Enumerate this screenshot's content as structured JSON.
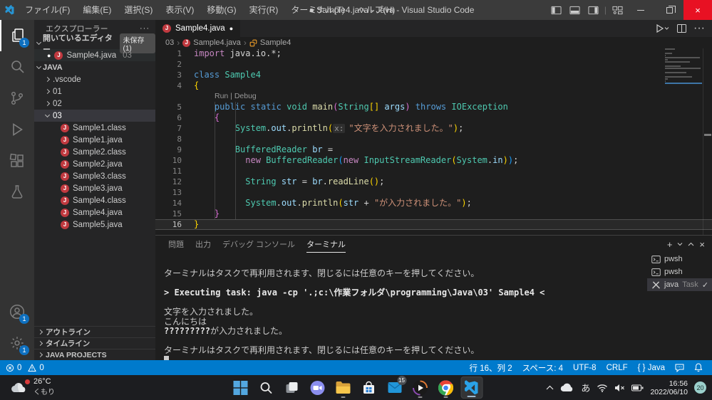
{
  "window": {
    "title": "● Sample4.java - Java - Visual Studio Code",
    "menus": [
      {
        "label": "ファイル(F)"
      },
      {
        "label": "編集(E)"
      },
      {
        "label": "選択(S)"
      },
      {
        "label": "表示(V)"
      },
      {
        "label": "移動(G)"
      },
      {
        "label": "実行(R)"
      },
      {
        "label": "ターミナル(T)"
      },
      {
        "label": "ヘルプ(H)"
      }
    ]
  },
  "activity_bar": {
    "top": [
      {
        "name": "explorer",
        "active": true,
        "badge": "1"
      },
      {
        "name": "search"
      },
      {
        "name": "source-control"
      },
      {
        "name": "run-debug"
      },
      {
        "name": "extensions"
      },
      {
        "name": "testing"
      }
    ],
    "bottom": [
      {
        "name": "accounts",
        "badge": "1"
      },
      {
        "name": "settings",
        "badge": "1"
      }
    ]
  },
  "sidebar": {
    "title": "エクスプローラー",
    "open_editors": {
      "label": "開いているエディター",
      "badge": "未保存 (1)",
      "items": [
        {
          "name": "Sample4.java",
          "folder": "03",
          "modified": true
        }
      ]
    },
    "workspace_label": "JAVA",
    "folders": [
      {
        "name": ".vscode"
      },
      {
        "name": "01"
      },
      {
        "name": "02"
      },
      {
        "name": "03",
        "expanded": true,
        "selected": true
      }
    ],
    "files": [
      "Sample1.class",
      "Sample1.java",
      "Sample2.class",
      "Sample2.java",
      "Sample3.class",
      "Sample3.java",
      "Sample4.class",
      "Sample4.java",
      "Sample5.java"
    ],
    "sections": [
      "アウトライン",
      "タイムライン",
      "JAVA PROJECTS"
    ]
  },
  "editor": {
    "tab": {
      "label": "Sample4.java",
      "modified": true
    },
    "breadcrumb": [
      "03",
      "Sample4.java",
      "Sample4"
    ],
    "code_lines": [
      {
        "n": "1",
        "t": [
          [
            "kw2",
            "import"
          ],
          [
            "pl",
            " java.io.*;"
          ]
        ]
      },
      {
        "n": "2",
        "t": []
      },
      {
        "n": "3",
        "t": [
          [
            "kw",
            "class"
          ],
          [
            "pl",
            " "
          ],
          [
            "ty",
            "Sample4"
          ]
        ]
      },
      {
        "n": "4",
        "t": [
          [
            "b1",
            "{"
          ]
        ]
      },
      {
        "lens": "Run | Debug"
      },
      {
        "n": "5",
        "t": [
          [
            "pl",
            "    "
          ],
          [
            "kw",
            "public"
          ],
          [
            "pl",
            " "
          ],
          [
            "kw",
            "static"
          ],
          [
            "pl",
            " "
          ],
          [
            "ty",
            "void"
          ],
          [
            "pl",
            " "
          ],
          [
            "fn",
            "main"
          ],
          [
            "b2",
            "("
          ],
          [
            "ty",
            "String"
          ],
          [
            "b1",
            "[]"
          ],
          [
            "pl",
            " "
          ],
          [
            "vr",
            "args"
          ],
          [
            "b2",
            ")"
          ],
          [
            "pl",
            " "
          ],
          [
            "kw",
            "throws"
          ],
          [
            "pl",
            " "
          ],
          [
            "ty",
            "IOException"
          ]
        ]
      },
      {
        "n": "6",
        "t": [
          [
            "pl",
            "    "
          ],
          [
            "b2",
            "{"
          ]
        ]
      },
      {
        "n": "7",
        "t": [
          [
            "pl",
            "        "
          ],
          [
            "ty",
            "System"
          ],
          [
            "pl",
            "."
          ],
          [
            "vr",
            "out"
          ],
          [
            "pl",
            "."
          ],
          [
            "fn",
            "println"
          ],
          [
            "b1",
            "("
          ],
          [
            "in",
            "x:"
          ],
          [
            "st",
            "\"文字を入力されました。\""
          ],
          [
            "b1",
            ")"
          ],
          [
            "pl",
            ";"
          ]
        ]
      },
      {
        "n": "8",
        "t": []
      },
      {
        "n": "9",
        "t": [
          [
            "pl",
            "        "
          ],
          [
            "ty",
            "BufferedReader"
          ],
          [
            "pl",
            " "
          ],
          [
            "vr",
            "br"
          ],
          [
            "pl",
            " ="
          ]
        ]
      },
      {
        "n": "10",
        "t": [
          [
            "pl",
            "          "
          ],
          [
            "kw2",
            "new"
          ],
          [
            "pl",
            " "
          ],
          [
            "ty",
            "BufferedReader"
          ],
          [
            "b3",
            "("
          ],
          [
            "kw2",
            "new"
          ],
          [
            "pl",
            " "
          ],
          [
            "ty",
            "InputStreamReader"
          ],
          [
            "b1",
            "("
          ],
          [
            "ty",
            "System"
          ],
          [
            "pl",
            "."
          ],
          [
            "vr",
            "in"
          ],
          [
            "b1",
            ")"
          ],
          [
            "b3",
            ")"
          ],
          [
            "pl",
            ";"
          ]
        ]
      },
      {
        "n": "11",
        "t": []
      },
      {
        "n": "12",
        "t": [
          [
            "pl",
            "          "
          ],
          [
            "ty",
            "String"
          ],
          [
            "pl",
            " "
          ],
          [
            "vr",
            "str"
          ],
          [
            "pl",
            " = "
          ],
          [
            "vr",
            "br"
          ],
          [
            "pl",
            "."
          ],
          [
            "fn",
            "readLine"
          ],
          [
            "b1",
            "()"
          ],
          [
            "pl",
            ";"
          ]
        ]
      },
      {
        "n": "13",
        "t": []
      },
      {
        "n": "14",
        "t": [
          [
            "pl",
            "          "
          ],
          [
            "ty",
            "System"
          ],
          [
            "pl",
            "."
          ],
          [
            "vr",
            "out"
          ],
          [
            "pl",
            "."
          ],
          [
            "fn",
            "println"
          ],
          [
            "b1",
            "("
          ],
          [
            "vr",
            "str"
          ],
          [
            "pl",
            " + "
          ],
          [
            "st",
            "\"が入力されました。\""
          ],
          [
            "b1",
            ")"
          ],
          [
            "pl",
            ";"
          ]
        ]
      },
      {
        "n": "15",
        "t": [
          [
            "pl",
            "    "
          ],
          [
            "b2",
            "}"
          ]
        ]
      },
      {
        "n": "16",
        "t": [
          [
            "b1",
            "}"
          ]
        ],
        "current": true
      }
    ]
  },
  "panel": {
    "tabs": [
      {
        "label": "問題"
      },
      {
        "label": "出力"
      },
      {
        "label": "デバッグ コンソール"
      },
      {
        "label": "ターミナル",
        "active": true
      }
    ],
    "terminal_lines": [
      {
        "seg": [
          {
            "t": "ターミナルはタスクで再利用されます、閉じるには任意のキーを押してください。"
          }
        ]
      },
      {
        "blank": true
      },
      {
        "seg": [
          {
            "t": "> Executing task: java -cp '.;c:\\作業フォルダ\\programming\\Java\\03' Sample4 <",
            "b": true
          }
        ]
      },
      {
        "blank": true
      },
      {
        "seg": [
          {
            "t": "文字を入力されました。"
          }
        ]
      },
      {
        "seg": [
          {
            "t": "こんにちは"
          }
        ]
      },
      {
        "seg": [
          {
            "t": "?????????",
            "b": true
          },
          {
            "t": "が入力されました。"
          }
        ]
      },
      {
        "blank": true
      },
      {
        "seg": [
          {
            "t": "ターミナルはタスクで再利用されます、閉じるには任意のキーを押してください。"
          }
        ]
      },
      {
        "cursor": true
      }
    ],
    "terminal_list": [
      {
        "icon": "terminal-icon",
        "label": "pwsh"
      },
      {
        "icon": "terminal-icon",
        "label": "pwsh"
      },
      {
        "icon": "tools-icon",
        "label": "java",
        "detail": "Task",
        "checked": true,
        "active": true
      }
    ]
  },
  "status_bar": {
    "left": [
      {
        "name": "errors",
        "value": "0"
      },
      {
        "name": "warnings",
        "value": "0"
      }
    ],
    "right": [
      {
        "name": "cursor-position",
        "label": "行 16、列 2"
      },
      {
        "name": "indentation",
        "label": "スペース: 4"
      },
      {
        "name": "encoding",
        "label": "UTF-8"
      },
      {
        "name": "eol",
        "label": "CRLF"
      },
      {
        "name": "language-mode",
        "label": "{ } Java"
      }
    ]
  },
  "taskbar": {
    "weather": {
      "temp": "26°C",
      "condition": "くもり"
    },
    "apps": [
      {
        "name": "start"
      },
      {
        "name": "search"
      },
      {
        "name": "task-view"
      },
      {
        "name": "chat"
      },
      {
        "name": "file-explorer",
        "running": true
      },
      {
        "name": "store"
      },
      {
        "name": "mail",
        "badge": "15"
      },
      {
        "name": "media-player",
        "running": true
      },
      {
        "name": "chrome",
        "running": true
      },
      {
        "name": "vscode",
        "running": true,
        "active": true
      }
    ],
    "tray": {
      "ime": "あ",
      "clock": {
        "time": "16:56",
        "date": "2022/06/10"
      },
      "notification_badge": "20"
    }
  },
  "colors": {
    "accent": "#007ACC",
    "statusbar_bg": "#007ACC",
    "close_button_bg": "#E81123",
    "java_file_icon": "#C0393F",
    "class_symbol_icon": "#EE9D28",
    "tokens": {
      "kw": "#569CD6",
      "kw2": "#C586C0",
      "ty": "#4EC9B0",
      "fn": "#DCDCAA",
      "vr": "#9CDCFE",
      "st": "#CE9178",
      "pl": "#D4D4D4",
      "b1": "#FFD700",
      "b2": "#DA70D6",
      "b3": "#179FFF",
      "in": "#969696",
      "lens": "#999999"
    }
  }
}
